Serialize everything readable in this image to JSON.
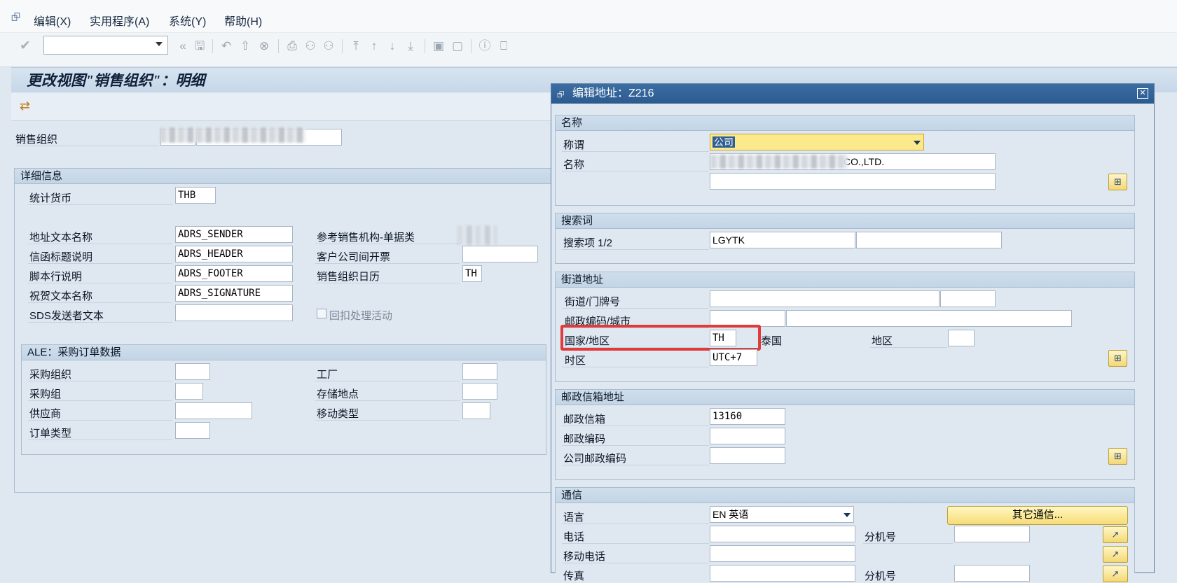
{
  "menu": {
    "items": [
      "编辑(X)",
      "实用程序(A)",
      "系统(Y)",
      "帮助(H)"
    ]
  },
  "page": {
    "title": "更改视图\"销售组织\"：明细"
  },
  "main": {
    "sales_org_label": "销售组织",
    "details_group": "详细信息",
    "stat_currency_label": "统计货币",
    "stat_currency_value": "THB",
    "addr_text_label": "地址文本名称",
    "addr_text_value": "ADRS_SENDER",
    "letter_header_label": "信函标题说明",
    "letter_header_value": "ADRS_HEADER",
    "footer_label": "脚本行说明",
    "footer_value": "ADRS_FOOTER",
    "greeting_label": "祝贺文本名称",
    "greeting_value": "ADRS_SIGNATURE",
    "sds_label": "SDS发送者文本",
    "ref_org_label": "参考销售机构-单据类",
    "intercompany_label": "客户公司间开票",
    "calendar_label": "销售组织日历",
    "calendar_value": "TH",
    "rebate_label": "回扣处理活动",
    "ale_group": "ALE：采购订单数据",
    "purch_org_label": "采购组织",
    "purch_group_label": "采购组",
    "vendor_label": "供应商",
    "order_type_label": "订单类型",
    "plant_label": "工厂",
    "storage_label": "存储地点",
    "movement_label": "移动类型"
  },
  "dialog": {
    "title": "编辑地址：Z216",
    "name_group": "名称",
    "title_label": "称谓",
    "title_value": "公司",
    "name_label": "名称",
    "name_value": "CO.,LTD.",
    "search_group": "搜索词",
    "search_label": "搜索项 1/2",
    "search_value": "LGYTK",
    "street_group": "街道地址",
    "street_label": "街道/门牌号",
    "postal_city_label": "邮政编码/城市",
    "country_label": "国家/地区",
    "country_value": "TH",
    "country_name": "泰国",
    "region_label": "地区",
    "timezone_label": "时区",
    "timezone_value": "UTC+7",
    "pobox_group": "邮政信箱地址",
    "pobox_label": "邮政信箱",
    "pobox_value": "13160",
    "pobox_postal_label": "邮政编码",
    "company_postal_label": "公司邮政编码",
    "comm_group": "通信",
    "language_label": "语言",
    "language_value": "EN 英语",
    "other_comm_button": "其它通信...",
    "phone_label": "电话",
    "ext_label": "分机号",
    "mobile_label": "移动电话",
    "fax_label": "传真",
    "ext2_label": "分机号"
  }
}
